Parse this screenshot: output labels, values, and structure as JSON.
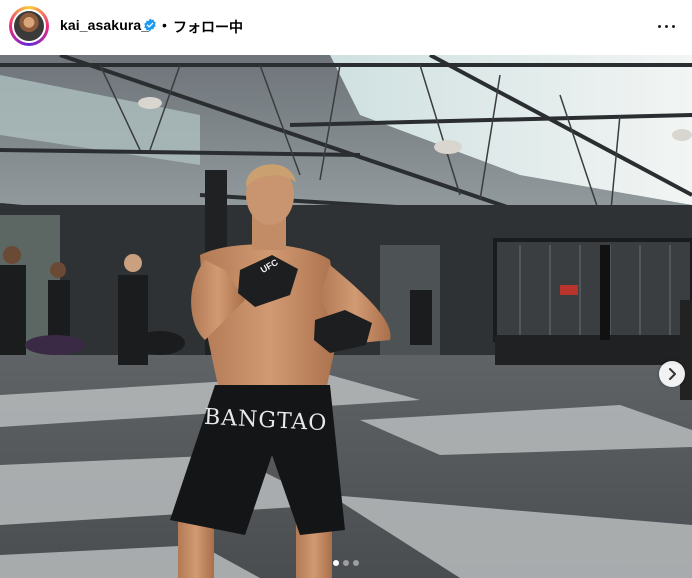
{
  "post_header": {
    "username": "kai_asakura_",
    "separator": "•",
    "follow_status": "フォロー中"
  },
  "photo": {
    "shorts_text": "BANGTAO",
    "glove_text": "UFC"
  },
  "carousel": {
    "slide_count": 3,
    "active_index": 0
  },
  "colors": {
    "verified_badge": "#1d9bf0",
    "header_bg": "#ffffff"
  },
  "icons": {
    "more": "more-icon",
    "next": "chevron-right-icon",
    "verified": "verified-badge-icon"
  }
}
